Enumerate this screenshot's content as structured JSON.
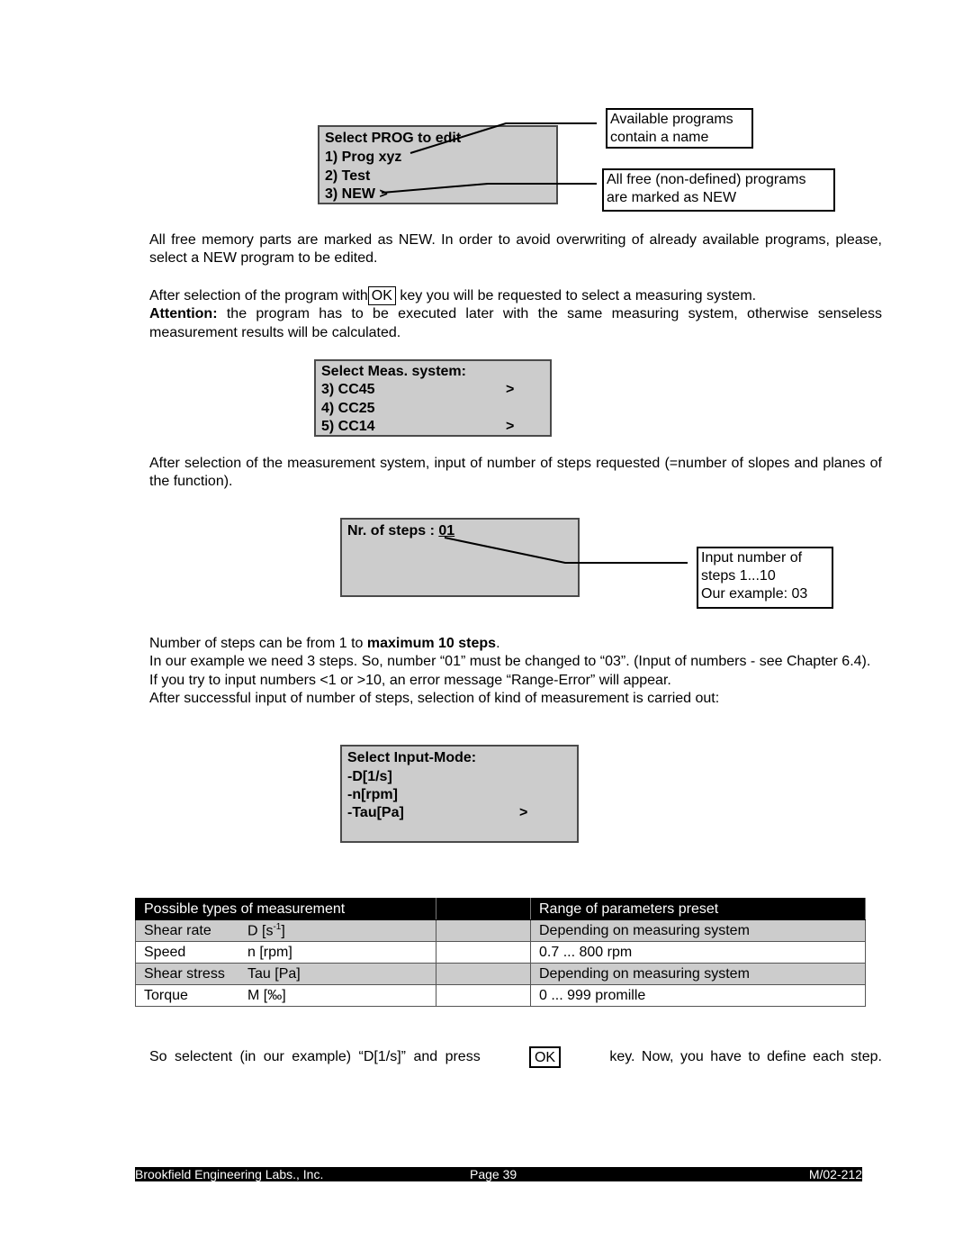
{
  "screen1": {
    "title": "Select PROG to edit",
    "items": [
      "1) Prog xyz",
      "2) Test",
      "3) NEW"
    ],
    "selected_marker": ">"
  },
  "callouts": {
    "available": [
      "Available programs",
      "contain a name"
    ],
    "free": [
      "All free (non-defined) programs",
      "are marked as NEW"
    ],
    "steps": [
      "Input number of",
      "steps 1...10",
      "Our example: 03"
    ]
  },
  "para1": "All free memory parts are marked as NEW. In order to avoid overwriting of already available programs, please, select a NEW program to be edited.",
  "para2": {
    "before_key": "After selection of the program with",
    "key": "OK",
    "after_key": " key you will be requested to select a measuring system.",
    "attention_label": "Attention:",
    "attention_text": " the program has to be executed later with the same measuring system, otherwise senseless measurement results will be calculated."
  },
  "screen2": {
    "title": "Select Meas. system:",
    "items": [
      {
        "label": "3) CC45",
        "marker": ">"
      },
      {
        "label": "4) CC25",
        "marker": ""
      },
      {
        "label": "5) CC14",
        "marker": ">"
      }
    ]
  },
  "para3": "After selection of the measurement system, input of number of steps requested (=number of slopes and planes of the function).",
  "screen3": {
    "label": "Nr. of steps : ",
    "value": "01"
  },
  "para4": {
    "line1_text": "Number of steps can be from 1 to ",
    "line1_bold": "maximum 10 steps",
    "line1_end": ".",
    "line2": "In our example we need 3 steps. So, number “01” must be changed to “03”. (Input of numbers - see Chapter 6.4).",
    "line3": "If you try to input numbers <1 or >10, an error message “Range-Error” will appear.",
    "line4": "After successful input of number of steps, selection of kind of measurement is carried out:"
  },
  "screen4": {
    "title": "Select Input-Mode:",
    "items": [
      {
        "label": "-D[1/s]",
        "marker": ""
      },
      {
        "label": "-n[rpm]",
        "marker": ""
      },
      {
        "label": "-Tau[Pa]",
        "marker": ">"
      }
    ]
  },
  "table": {
    "headers": [
      "Possible types of measurement",
      "",
      "Range of parameters preset"
    ],
    "rows": [
      {
        "type": "Shear rate",
        "symbol": "D [s",
        "sup": "-1",
        "symbol_end": "]",
        "range": "Depending on measuring system"
      },
      {
        "type": "Speed",
        "symbol": "n [rpm]",
        "sup": "",
        "symbol_end": "",
        "range": "0.7 ... 800 rpm"
      },
      {
        "type": "Shear stress",
        "symbol": "Tau [Pa]",
        "sup": "",
        "symbol_end": "",
        "range": "Depending on measuring system"
      },
      {
        "type": "Torque",
        "symbol": "M [‰]",
        "sup": "",
        "symbol_end": "",
        "range": "0 ... 999 promille"
      }
    ]
  },
  "para5": {
    "before_key": "So selectent (in our example) “D[1/s]” and press",
    "key": "OK",
    "after_key": "key. Now, you have to define each step."
  },
  "footer": {
    "company": "Brookfield Engineering Labs., Inc.",
    "page": "Page 39",
    "doc_id": "M/02-212"
  }
}
